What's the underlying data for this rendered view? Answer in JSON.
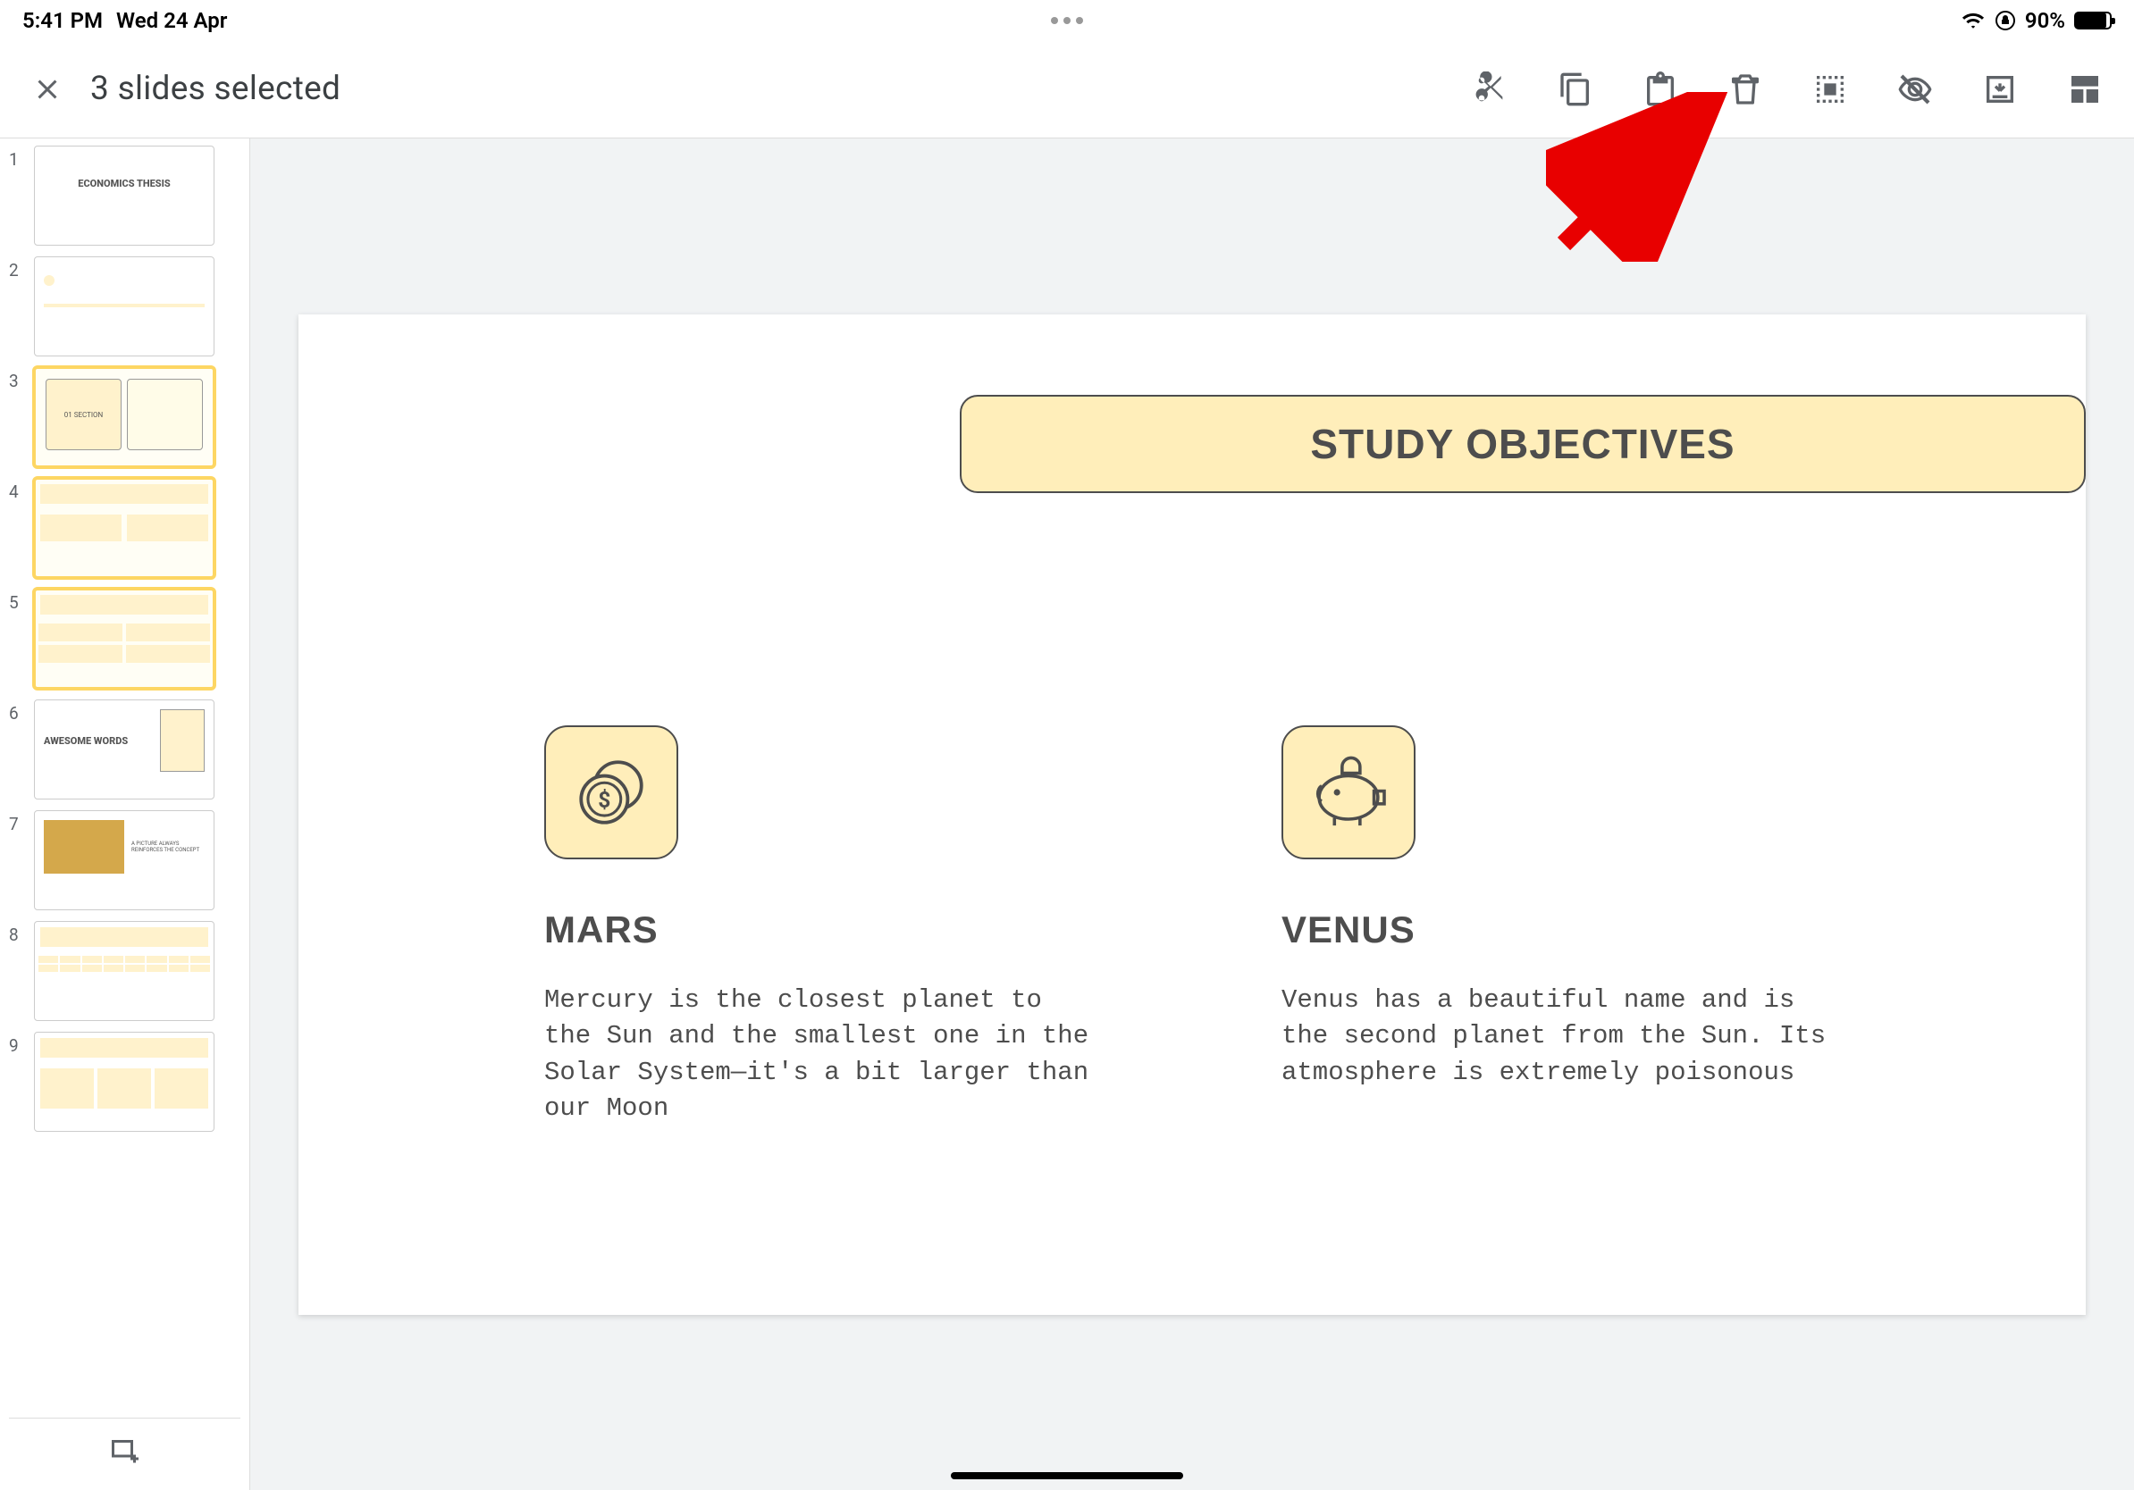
{
  "status": {
    "time": "5:41 PM",
    "date": "Wed 24 Apr",
    "battery_pct": "90%"
  },
  "toolbar": {
    "title": "3 slides selected"
  },
  "thumbnails": [
    {
      "num": "1",
      "selected": false,
      "label": "ECONOMICS THESIS"
    },
    {
      "num": "2",
      "selected": false,
      "label": ""
    },
    {
      "num": "3",
      "selected": true,
      "label": "01 SECTION"
    },
    {
      "num": "4",
      "selected": true,
      "label": ""
    },
    {
      "num": "5",
      "selected": true,
      "label": ""
    },
    {
      "num": "6",
      "selected": false,
      "label": "AWESOME WORDS"
    },
    {
      "num": "7",
      "selected": false,
      "label": "A PICTURE ALWAYS REINFORCES THE CONCEPT"
    },
    {
      "num": "8",
      "selected": false,
      "label": ""
    },
    {
      "num": "9",
      "selected": false,
      "label": ""
    }
  ],
  "slide": {
    "banner": "STUDY OBJECTIVES",
    "left": {
      "heading": "MARS",
      "body": "Mercury is the closest planet to the Sun and the smallest one in the Solar System—it's a bit larger than our Moon"
    },
    "right": {
      "heading": "VENUS",
      "body": "Venus has a beautiful name and is the second planet from the Sun. Its atmosphere is extremely poisonous"
    }
  }
}
